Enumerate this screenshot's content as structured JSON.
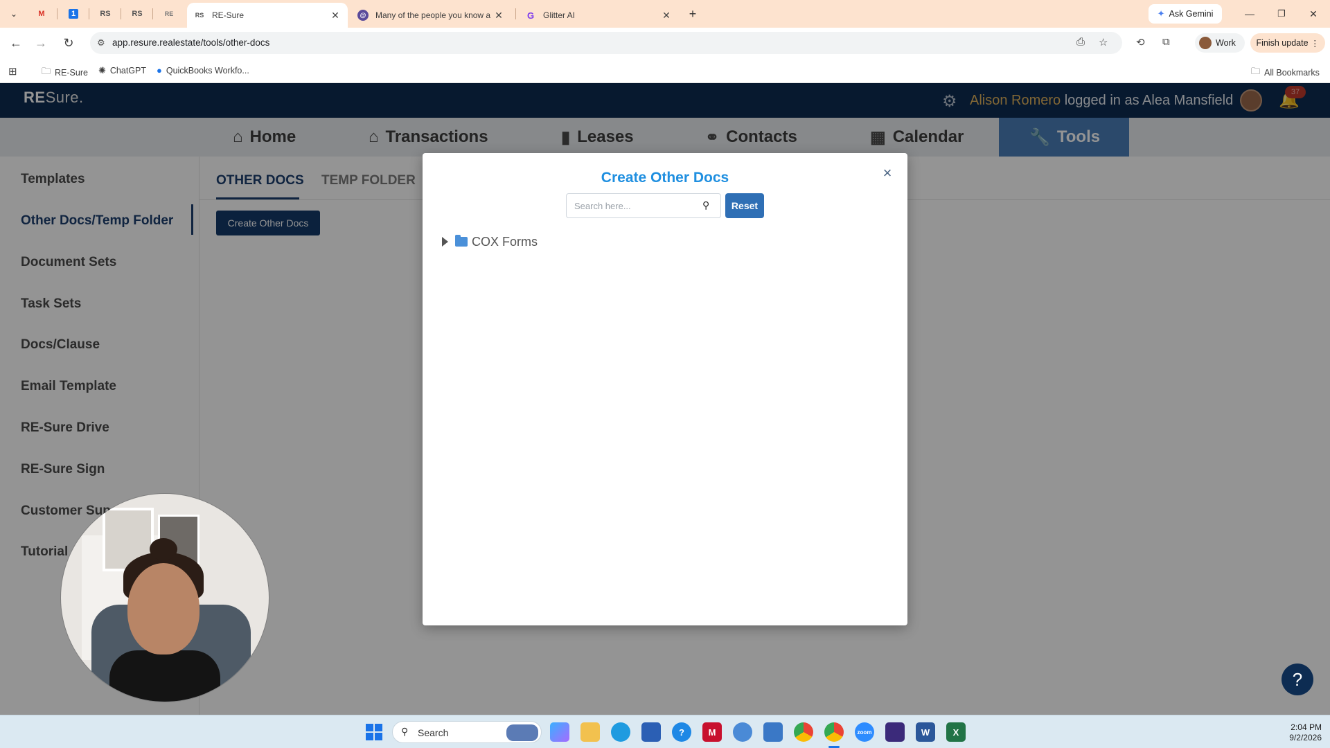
{
  "browser": {
    "tabs": [
      {
        "title": "RE-Sure",
        "favicon": "RS",
        "active": true
      },
      {
        "title": "Many of the people you know a",
        "favicon": "threads-icon",
        "active": false
      },
      {
        "title": "Glitter AI",
        "favicon": "G",
        "active": false
      }
    ],
    "pinned_tabs": [
      "gmail-icon",
      "1",
      "RS",
      "RS",
      "RE"
    ],
    "ask_gemini": "Ask Gemini",
    "url": "app.resure.realestate/tools/other-docs",
    "profile": "Work",
    "finish_update": "Finish update",
    "bookmarks": [
      "RE-Sure",
      "ChatGPT",
      "QuickBooks Workfo..."
    ],
    "all_bookmarks": "All Bookmarks"
  },
  "app": {
    "logo_main": "RE",
    "logo_sub": "Sure.",
    "user_name": "Alison Romero",
    "logged_in_as": "logged in as Alea Mansfield",
    "notification_count": "37",
    "nav": [
      {
        "label": "Home",
        "icon": "home-icon"
      },
      {
        "label": "Transactions",
        "icon": "house-icon"
      },
      {
        "label": "Leases",
        "icon": "file-icon"
      },
      {
        "label": "Contacts",
        "icon": "handshake-icon"
      },
      {
        "label": "Calendar",
        "icon": "calendar-icon"
      },
      {
        "label": "Tools",
        "icon": "wrench-icon",
        "active": true
      }
    ],
    "sidebar": [
      "Templates",
      "Other Docs/Temp Folder",
      "Document Sets",
      "Task Sets",
      "Docs/Clause",
      "Email Template",
      "RE-Sure Drive",
      "RE-Sure Sign",
      "Customer Sup",
      "Tutorial"
    ],
    "subtabs": [
      "OTHER DOCS",
      "TEMP FOLDER"
    ],
    "create_button": "Create Other Docs"
  },
  "modal": {
    "title": "Create Other Docs",
    "search_placeholder": "Search here...",
    "reset": "Reset",
    "folders": [
      "COX Forms"
    ]
  },
  "taskbar": {
    "search": "Search",
    "time": "2:04 PM",
    "date": "9/2/2026"
  },
  "colors": {
    "header_navy": "#0d2c52",
    "nav_active": "#4a7fb8",
    "modal_title": "#1f8fe0",
    "reset_button": "#2f6fb5",
    "user_name_gold": "#e0b25c"
  }
}
